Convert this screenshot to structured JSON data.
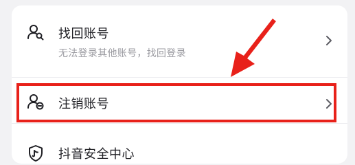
{
  "rows": [
    {
      "title": "找回账号",
      "subtitle": "无法登录其他账号，找回登录",
      "icon": "user-search-icon",
      "chevron": "chevron-right-icon"
    },
    {
      "title": "注销账号",
      "icon": "user-remove-icon",
      "chevron": "chevron-right-icon"
    },
    {
      "title": "抖音安全中心",
      "icon": "shield-icon"
    }
  ],
  "annotation": {
    "color": "#e8211a"
  }
}
